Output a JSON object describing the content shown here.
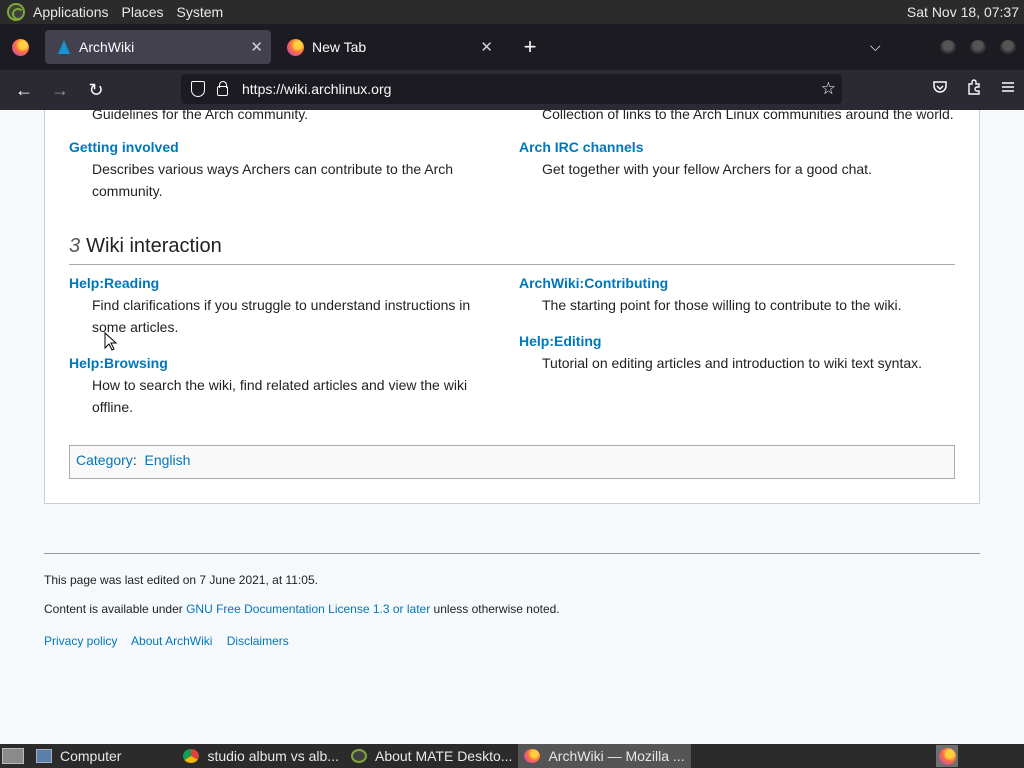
{
  "top_panel": {
    "menus": [
      "Applications",
      "Places",
      "System"
    ],
    "clock": "Sat Nov 18, 07:37"
  },
  "browser": {
    "tabs": [
      {
        "label": "ArchWiki",
        "close": "✕"
      },
      {
        "label": "New Tab",
        "close": "✕"
      }
    ],
    "new_tab": "+",
    "tab_list": "⌵",
    "url": "https://wiki.archlinux.org",
    "back": "←",
    "forward": "→",
    "reload": "↻",
    "bookmark_star": "☆"
  },
  "page": {
    "cut_left_text": "Guidelines for the Arch community.",
    "cut_right_text": "Collection of links to the Arch Linux communities around the world.",
    "getting_involved": {
      "title": "Getting involved",
      "desc": "Describes various ways Archers can contribute to the Arch community."
    },
    "irc": {
      "title": "Arch IRC channels",
      "desc": "Get together with your fellow Archers for a good chat."
    },
    "section": {
      "number": "3",
      "title": "Wiki interaction"
    },
    "help_reading": {
      "title": "Help:Reading",
      "desc": "Find clarifications if you struggle to understand instructions in some articles."
    },
    "help_browsing": {
      "title": "Help:Browsing",
      "desc": "How to search the wiki, find related articles and view the wiki offline."
    },
    "contributing": {
      "title": "ArchWiki:Contributing",
      "desc": "The starting point for those willing to contribute to the wiki."
    },
    "help_editing": {
      "title": "Help:Editing",
      "desc": "Tutorial on editing articles and introduction to wiki text syntax."
    },
    "category": {
      "label": "Category",
      "sep": ":",
      "value": "English"
    }
  },
  "footer": {
    "last_edited": "This page was last edited on 7 June 2021, at 11:05.",
    "license_prefix": "Content is available under ",
    "license_link": "GNU Free Documentation License 1.3 or later",
    "license_suffix": " unless otherwise noted.",
    "links": [
      "Privacy policy",
      "About ArchWiki",
      "Disclaimers"
    ]
  },
  "taskbar": {
    "items": [
      {
        "label": "Computer"
      },
      {
        "label": "studio album vs alb..."
      },
      {
        "label": "About MATE Deskto..."
      },
      {
        "label": "ArchWiki — Mozilla ..."
      }
    ]
  },
  "colors": {
    "link": "#0077bb",
    "panel": "#2b2b2b",
    "firefox_toolbar": "#2b2a33"
  }
}
